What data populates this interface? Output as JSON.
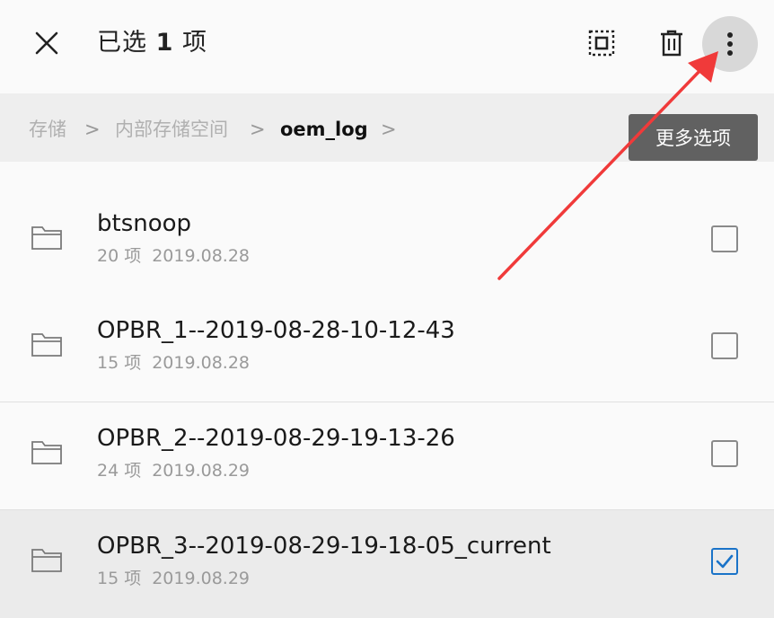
{
  "header": {
    "title_prefix": "已选",
    "selected_count": "1",
    "title_suffix": "项",
    "close_icon": "close-icon",
    "select_all_icon": "select-all-icon",
    "delete_icon": "trash-icon",
    "more_icon": "more-vertical-icon"
  },
  "breadcrumb": {
    "items": [
      "存储",
      "内部存储空间",
      "oem_log"
    ],
    "separator": ">"
  },
  "tooltip": {
    "text": "更多选项"
  },
  "files": [
    {
      "name": "btsnoop",
      "count": "20 项",
      "date": "2019.08.28",
      "checked": false
    },
    {
      "name": "OPBR_1--2019-08-28-10-12-43",
      "count": "15 项",
      "date": "2019.08.28",
      "checked": false
    },
    {
      "name": "OPBR_2--2019-08-29-19-13-26",
      "count": "24 项",
      "date": "2019.08.29",
      "checked": false
    },
    {
      "name": "OPBR_3--2019-08-29-19-18-05_current",
      "count": "15 项",
      "date": "2019.08.29",
      "checked": true
    }
  ],
  "colors": {
    "accent": "#1a73c8",
    "annotation_arrow": "#f03a3a"
  }
}
